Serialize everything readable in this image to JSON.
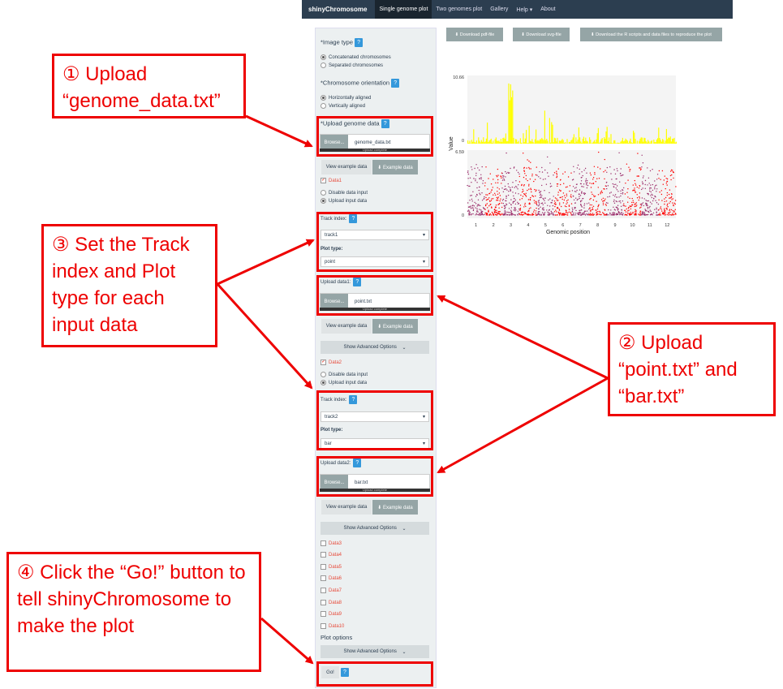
{
  "navbar": {
    "brand": "shinyChromosome",
    "items": [
      "Single genome plot",
      "Two genomes plot",
      "Gallery",
      "Help ▾",
      "About"
    ]
  },
  "top_buttons": {
    "pdf": "⬇ Download pdf-file",
    "svg": "⬇ Download svg-file",
    "scripts": "⬇ Download the R scripts and data files to reproduce the plot"
  },
  "sidebar": {
    "image_type_label": "*Image type",
    "image_type_opt1": "Concatenated chromosomes",
    "image_type_opt2": "Separated chromosomes",
    "orientation_label": "*Chromosome orientation",
    "orientation_opt1": "Horizontally aligned",
    "orientation_opt2": "Vertically aligned",
    "upload_genome_label": "*Upload genome data",
    "browse": "Browse...",
    "genome_file": "genome_data.txt",
    "upload_complete": "Upload complete",
    "view_example": "View example data",
    "example_data": "⬇ Example data",
    "data1": "Data1",
    "disable_input": "Disable data input",
    "upload_input": "Upload input data",
    "track_index_label": "Track index:",
    "track1": "track1",
    "plot_type_label": "Plot type:",
    "plot_type1": "point",
    "upload_data1_label": "Upload data1:",
    "data1_file": "point.txt",
    "show_advanced": "Show Advanced Options",
    "data2": "Data2",
    "track2": "track2",
    "plot_type2": "bar",
    "upload_data2_label": "Upload data2:",
    "data2_file": "bar.txt",
    "data_more": [
      "Data3",
      "Data4",
      "Data5",
      "Data6",
      "Data7",
      "Data8",
      "Data9",
      "Data10"
    ],
    "plot_options": "Plot options",
    "go": "Go!",
    "help_glyph": "?"
  },
  "chart_data": {
    "type": "scatter",
    "xlabel": "Genomic position",
    "ylabel": "Value",
    "x_ticks": [
      "1",
      "2",
      "3",
      "4",
      "5",
      "6",
      "7",
      "8",
      "9",
      "10",
      "11",
      "12"
    ],
    "top_track_ticks": [
      "10.66",
      "0"
    ],
    "bottom_track_ticks": [
      "6.59",
      "0"
    ],
    "colors": {
      "bar": "#ffff00",
      "point_a": "#9b2d6b",
      "point_b": "#ff0000"
    }
  },
  "annotations": {
    "a1": "① Upload “genome_data.txt”",
    "a2": "② Upload “point.txt” and “bar.txt”",
    "a3": "③ Set the Track index and Plot type for each input data",
    "a4": "④ Click the “Go!” button to tell shinyChromosome to make the plot"
  }
}
